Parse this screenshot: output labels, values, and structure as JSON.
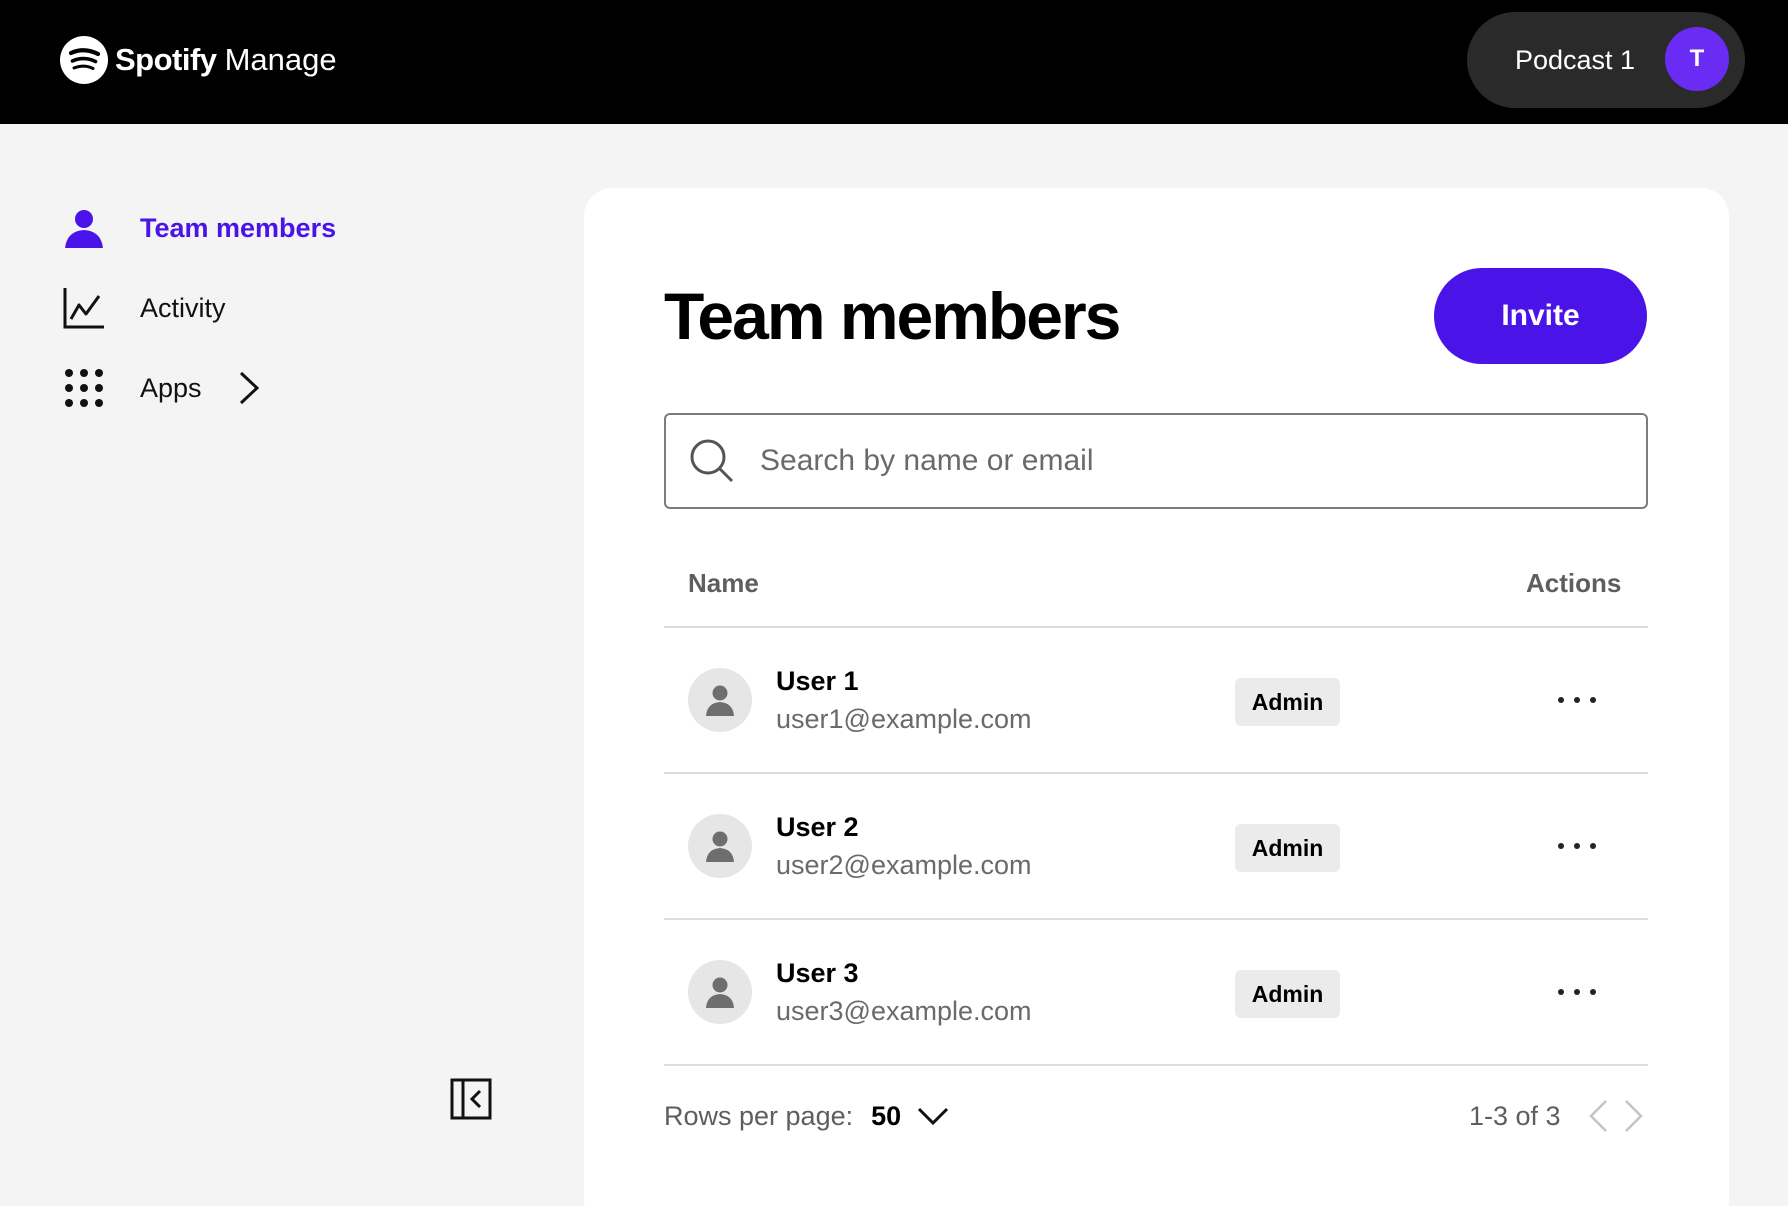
{
  "header": {
    "brand": "Spotify",
    "product": "Manage",
    "account_label": "Podcast 1",
    "avatar_initial": "T"
  },
  "sidebar": {
    "items": [
      {
        "label": "Team members",
        "icon": "person-icon",
        "active": true
      },
      {
        "label": "Activity",
        "icon": "chart-line-icon",
        "active": false
      },
      {
        "label": "Apps",
        "icon": "grid-icon",
        "active": false
      }
    ]
  },
  "main": {
    "title": "Team members",
    "invite_label": "Invite",
    "search_placeholder": "Search by name or email",
    "columns": {
      "name": "Name",
      "actions": "Actions"
    },
    "members": [
      {
        "name": "User 1",
        "email": "user1@example.com",
        "role": "Admin"
      },
      {
        "name": "User 2",
        "email": "user2@example.com",
        "role": "Admin"
      },
      {
        "name": "User 3",
        "email": "user3@example.com",
        "role": "Admin"
      }
    ],
    "pagination": {
      "rows_label": "Rows per page:",
      "rows_value": "50",
      "range": "1-3 of 3"
    }
  },
  "colors": {
    "accent": "#4a13e8",
    "avatar": "#6a2bf4",
    "topbar": "#000000",
    "background": "#f4f4f4"
  }
}
